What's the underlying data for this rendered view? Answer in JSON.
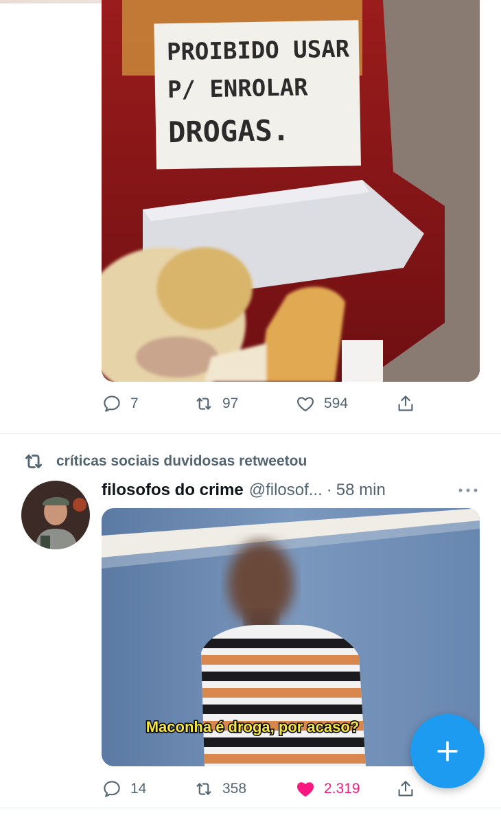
{
  "tweet1": {
    "image_sign_text": [
      "PROIBIDO USAR",
      "P/ ENROLAR",
      "DROGAS."
    ],
    "actions": {
      "replies": "7",
      "retweets": "97",
      "likes": "594"
    }
  },
  "tweet2": {
    "retweeted_by": "críticas sociais duvidosas retweetou",
    "author_name": "filosofos do crime",
    "author_handle": "@filosof...",
    "separator": "·",
    "time": "58 min",
    "image_caption": "Maconha é droga, por acaso?",
    "actions": {
      "replies": "14",
      "retweets": "358",
      "likes": "2.319"
    }
  },
  "icons": {
    "reply": "reply-icon",
    "retweet": "retweet-icon",
    "like": "heart-icon",
    "share": "share-icon",
    "more": "more-icon",
    "compose": "plus-icon"
  },
  "colors": {
    "accent": "#1d9bf0",
    "like_active": "#f91880",
    "muted_text": "#536471"
  }
}
